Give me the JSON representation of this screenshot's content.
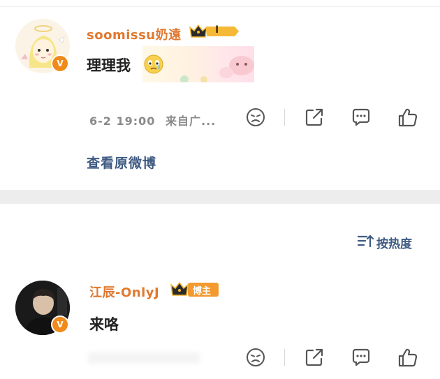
{
  "comments": [
    {
      "username": "soomissu奶遠",
      "level_badge": "I",
      "text": "理理我",
      "timestamp": "6-2 19:00",
      "source": "来自广...",
      "view_original": "查看原微博"
    },
    {
      "username": "江辰-OnlyJ",
      "author_badge": "博主",
      "text": "来咯"
    }
  ],
  "sort": {
    "label": "按热度"
  },
  "colors": {
    "username": "#e0782f",
    "link": "#3e5a82",
    "meta": "#8a8a8a",
    "badge_orange": "#f08a1c",
    "gold": "#f5b935",
    "divider_band": "#ededed"
  },
  "icons": [
    "dislike-icon",
    "share-icon",
    "comment-icon",
    "like-icon",
    "sort-icon",
    "crown-icon",
    "verified-icon"
  ]
}
